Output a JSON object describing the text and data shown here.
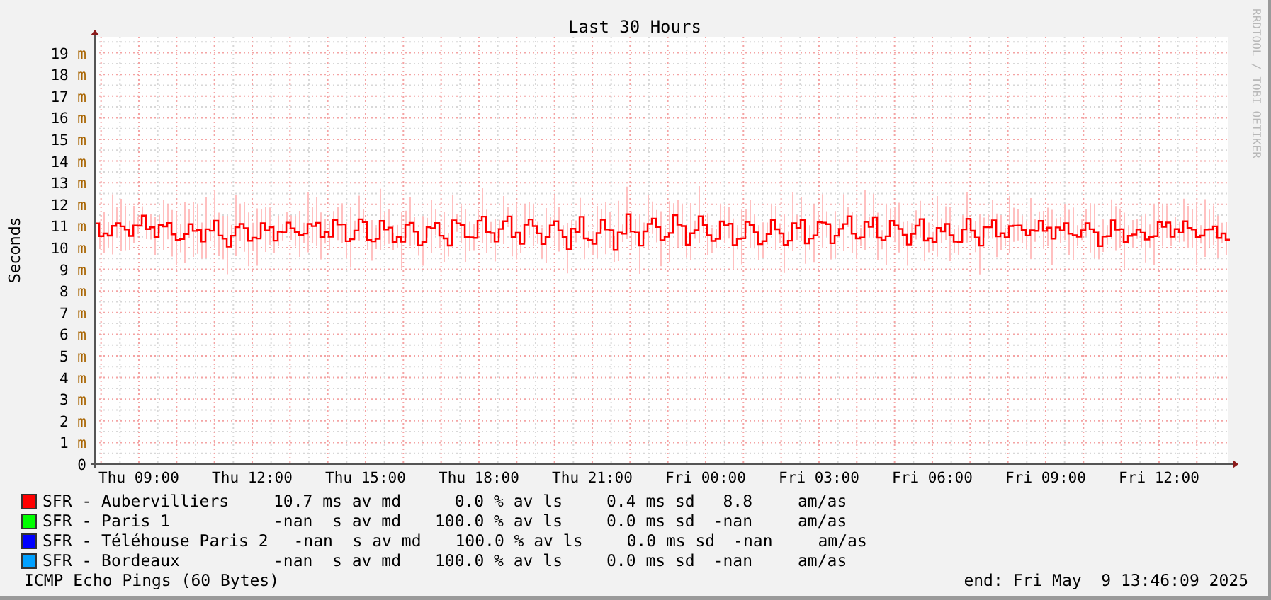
{
  "title": "Last 30 Hours",
  "y_axis": {
    "label": "Seconds",
    "ticks": [
      "19 m",
      "18 m",
      "17 m",
      "16 m",
      "15 m",
      "14 m",
      "13 m",
      "12 m",
      "11 m",
      "10 m",
      "9 m",
      "8 m",
      "7 m",
      "6 m",
      "5 m",
      "4 m",
      "3 m",
      "2 m",
      "1 m",
      "0"
    ]
  },
  "x_axis": {
    "ticks": [
      "Thu 09:00",
      "Thu 12:00",
      "Thu 15:00",
      "Thu 18:00",
      "Thu 21:00",
      "Fri 00:00",
      "Fri 03:00",
      "Fri 06:00",
      "Fri 09:00",
      "Fri 12:00"
    ]
  },
  "credit": "RRDTOOL / TOBI OETIKER",
  "legend": [
    {
      "name": "SFR - Aubervilliers",
      "color": "#ff0000",
      "median": "10.7 ms av md",
      "loss": "0.0 % av ls",
      "sd": "0.4 ms sd",
      "ratio": "8.8",
      "ratio_unit": "am/as"
    },
    {
      "name": "SFR - Paris 1",
      "color": "#00ff00",
      "median": "-nan  s av md",
      "loss": "100.0 % av ls",
      "sd": "0.0 ms sd",
      "ratio": "-nan",
      "ratio_unit": "am/as"
    },
    {
      "name": "SFR - Téléhouse Paris 2",
      "color": "#0000ff",
      "median": "-nan  s av md",
      "loss": "100.0 % av ls",
      "sd": "0.0 ms sd",
      "ratio": "-nan",
      "ratio_unit": "am/as"
    },
    {
      "name": "SFR - Bordeaux",
      "color": "#00a0ff",
      "median": "-nan  s av md",
      "loss": "100.0 % av ls",
      "sd": "0.0 ms sd",
      "ratio": "-nan",
      "ratio_unit": "am/as"
    }
  ],
  "footer": {
    "probe": "ICMP Echo Pings (60 Bytes)",
    "end": "end: Fri May  9 13:46:09 2025"
  }
}
